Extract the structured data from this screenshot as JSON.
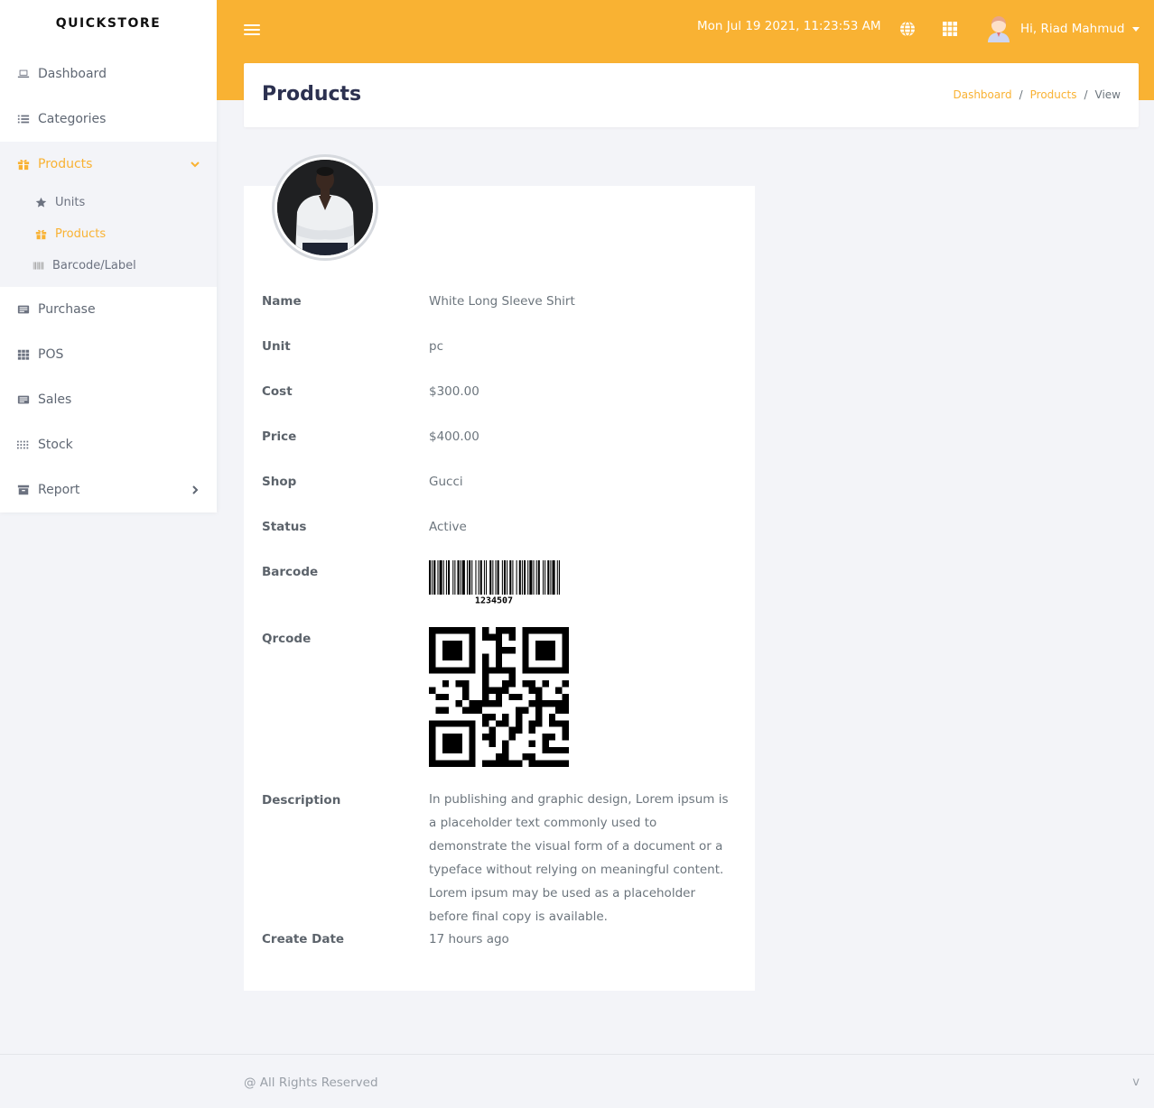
{
  "brand": "QUICKSTORE",
  "sidebar": {
    "items": [
      {
        "label": "Dashboard",
        "icon": "laptop-icon"
      },
      {
        "label": "Categories",
        "icon": "list-icon"
      },
      {
        "label": "Products",
        "icon": "gift-icon"
      },
      {
        "label": "Purchase",
        "icon": "receipt-icon"
      },
      {
        "label": "POS",
        "icon": "grid-icon"
      },
      {
        "label": "Sales",
        "icon": "receipt-icon"
      },
      {
        "label": "Stock",
        "icon": "dots-grid-icon"
      },
      {
        "label": "Report",
        "icon": "archive-icon"
      }
    ],
    "products_sub": [
      {
        "label": "Units",
        "icon": "star-icon"
      },
      {
        "label": "Products",
        "icon": "gift-icon"
      },
      {
        "label": "Barcode/Label",
        "icon": "barcode-icon"
      }
    ]
  },
  "topbar": {
    "datetime": "Mon Jul 19 2021, 11:23:53 AM",
    "user_greeting": "Hi, Riad Mahmud"
  },
  "page": {
    "title": "Products",
    "breadcrumb": [
      "Dashboard",
      "Products",
      "View"
    ]
  },
  "product": {
    "labels": {
      "name": "Name",
      "unit": "Unit",
      "cost": "Cost",
      "price": "Price",
      "shop": "Shop",
      "status": "Status",
      "barcode": "Barcode",
      "qrcode": "Qrcode",
      "description": "Description",
      "create_date": "Create Date"
    },
    "name": "White Long Sleeve Shirt",
    "unit": "pc",
    "cost": "$300.00",
    "price": "$400.00",
    "shop": "Gucci",
    "status": "Active",
    "barcode_number": "1234507",
    "description": "In publishing and graphic design, Lorem ipsum is a placeholder text commonly used to demonstrate the visual form of a document or a typeface without relying on meaningful content. Lorem ipsum may be used as a placeholder before final copy is available.",
    "create_date": "17 hours ago"
  },
  "footer": {
    "text": "@ All Rights Reserved",
    "right": "v"
  },
  "colors": {
    "accent": "#f9b233",
    "title": "#2c3150",
    "background": "#f3f4f8"
  }
}
